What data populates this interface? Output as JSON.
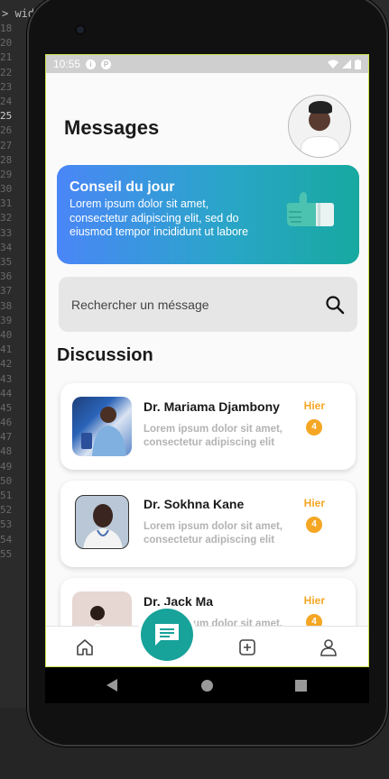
{
  "ide": {
    "tab_label": "> wid",
    "line_numbers": [
      "18",
      "20",
      "21",
      "22",
      "23",
      "24",
      "25",
      "26",
      "27",
      "28",
      "29",
      "30",
      "31",
      "32",
      "33",
      "34",
      "35",
      "36",
      "37",
      "38",
      "39",
      "40",
      "41",
      "42",
      "43",
      "44",
      "45",
      "46",
      "47",
      "48",
      "49",
      "50",
      "51",
      "52",
      "53",
      "54",
      "55"
    ],
    "current_line": "25"
  },
  "statusbar": {
    "time": "10:55"
  },
  "header": {
    "title": "Messages"
  },
  "tip": {
    "title": "Conseil du jour",
    "text": "Lorem ipsum dolor sit amet, consectetur adipiscing elit, sed do eiusmod tempor incididunt ut labore"
  },
  "search": {
    "placeholder": "Rechercher un méssage"
  },
  "discussion": {
    "title": "Discussion",
    "conversations": [
      {
        "name": "Dr. Mariama Djambony",
        "preview": "Lorem ipsum dolor sit amet, consectetur adipiscing elit",
        "time": "Hier",
        "unread": "4"
      },
      {
        "name": "Dr. Sokhna Kane",
        "preview": "Lorem ipsum dolor sit amet, consectetur adipiscing elit",
        "time": "Hier",
        "unread": "4"
      },
      {
        "name": "Dr. Jack Ma",
        "preview": "Lorem ipsum dolor sit amet.",
        "time": "Hier",
        "unread": "4"
      }
    ]
  },
  "colors": {
    "accent": "#17a29a",
    "badge": "#f5a623",
    "gradient_start": "#4a86f7",
    "gradient_end": "#17a9a0"
  },
  "nav": {
    "items": [
      "home-icon",
      "add-square-icon",
      "chat-icon",
      "profile-icon"
    ]
  }
}
